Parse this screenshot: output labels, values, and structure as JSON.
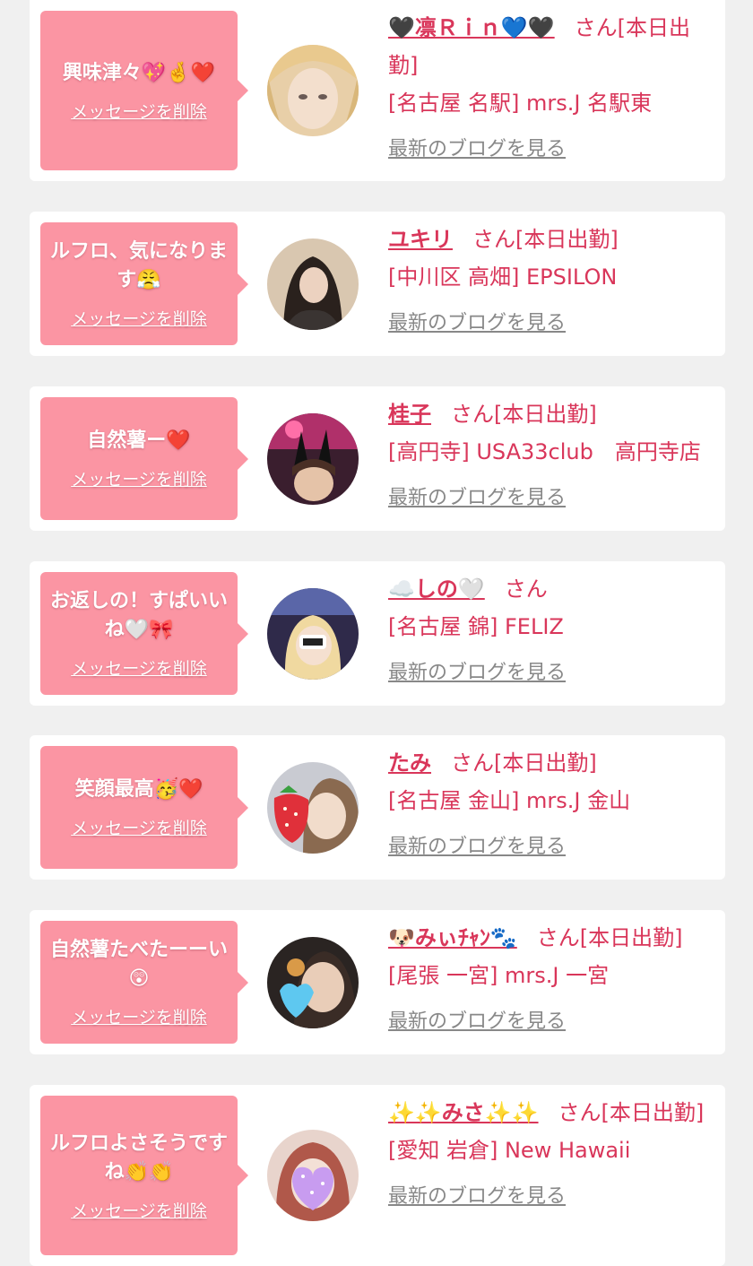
{
  "delete_label": "メッセージを削除",
  "blog_label": "最新のブログを見る",
  "san_label": "さん",
  "cards": [
    {
      "message": "興味津々💖🤞❤️",
      "name": "🖤️凛Ｒｉｎ💙🖤",
      "status": "[本日出勤]",
      "shop": "[名古屋 名駅] mrs.J 名駅東"
    },
    {
      "message": "ルフロ、気になります😤",
      "name": "ユキリ",
      "status": "[本日出勤]",
      "shop": "[中川区 高畑] EPSILON"
    },
    {
      "message": "自然薯ー❤️",
      "name": "桂子",
      "status": "[本日出勤]",
      "shop": "[高円寺] USA33club　高円寺店"
    },
    {
      "message": "お返しの！すぱいいね🤍🎀",
      "name": "☁️しの🤍",
      "status": "",
      "shop": "[名古屋 錦] FELIZ"
    },
    {
      "message": "笑顔最高🥳❤️",
      "name": "たみ",
      "status": "[本日出勤]",
      "shop": "[名古屋 金山] mrs.J 金山"
    },
    {
      "message": "自然薯たべたーーい😲",
      "name": "🐶みぃﾁｬﾝ🐾",
      "status": "[本日出勤]",
      "shop": "[尾張 一宮] mrs.J 一宮"
    },
    {
      "message": "ルフロよさそうですね👏👏",
      "name": "✨✨みさ✨✨",
      "status": "[本日出勤]",
      "shop": "[愛知 岩倉] New Hawaii"
    }
  ]
}
